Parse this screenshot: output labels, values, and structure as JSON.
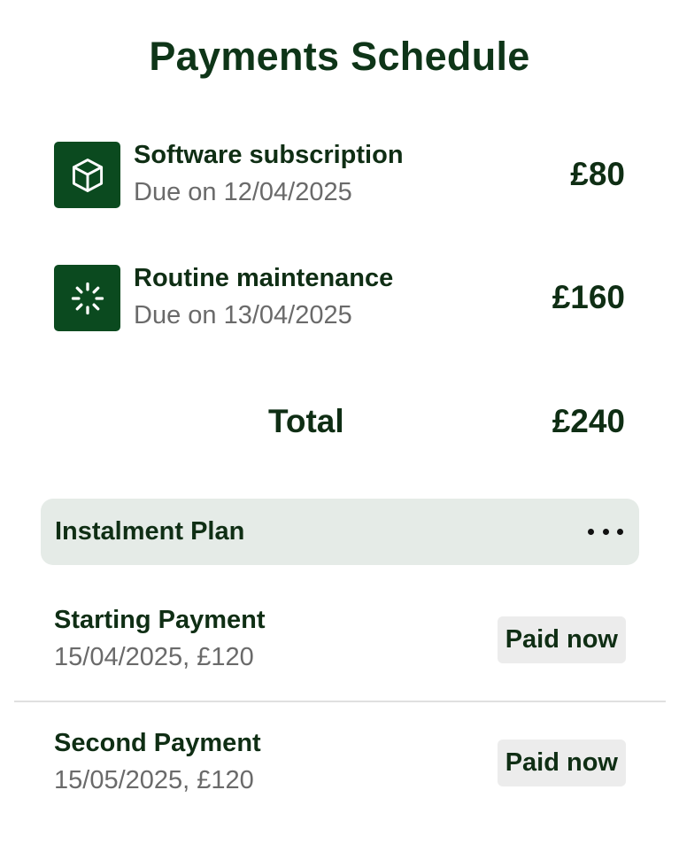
{
  "page": {
    "title": "Payments Schedule"
  },
  "items": [
    {
      "icon": "box-icon",
      "name": "Software subscription",
      "due": "Due on 12/04/2025",
      "amount": "£80"
    },
    {
      "icon": "loader-icon",
      "name": "Routine maintenance",
      "due": "Due on 13/04/2025",
      "amount": "£160"
    }
  ],
  "total": {
    "label": "Total",
    "amount": "£240"
  },
  "plan": {
    "title": "Instalment Plan",
    "menu_icon": "more-horizontal-icon",
    "payments": [
      {
        "name": "Starting Payment",
        "detail": "15/04/2025, £120",
        "status": "Paid now"
      },
      {
        "name": "Second Payment",
        "detail": "15/05/2025, £120",
        "status": "Paid now"
      }
    ]
  },
  "colors": {
    "brand_dark_green": "#0b4a1f",
    "text_dark": "#0f2e14",
    "text_muted": "#6a6a6a",
    "plan_header_bg": "#e5ebe7",
    "badge_bg": "#ececec"
  }
}
